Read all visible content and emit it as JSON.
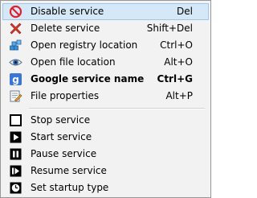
{
  "menu": {
    "items": [
      {
        "label": "Disable service",
        "shortcut": "Del",
        "icon": "disable-icon"
      },
      {
        "label": "Delete service",
        "shortcut": "Shift+Del",
        "icon": "delete-x-icon"
      },
      {
        "label": "Open registry location",
        "shortcut": "Ctrl+O",
        "icon": "registry-icon"
      },
      {
        "label": "Open file location",
        "shortcut": "Alt+O",
        "icon": "eye-icon"
      },
      {
        "label": "Google service name",
        "shortcut": "Ctrl+G",
        "icon": "google-icon"
      },
      {
        "label": "File properties",
        "shortcut": "Alt+P",
        "icon": "file-properties-icon"
      },
      {
        "label": "Stop service",
        "shortcut": "",
        "icon": "stop-icon"
      },
      {
        "label": "Start service",
        "shortcut": "",
        "icon": "play-icon"
      },
      {
        "label": "Pause service",
        "shortcut": "",
        "icon": "pause-icon"
      },
      {
        "label": "Resume service",
        "shortcut": "",
        "icon": "resume-icon"
      },
      {
        "label": "Set startup type",
        "shortcut": "",
        "icon": "clock-icon"
      }
    ],
    "highlighted_item": "Disable service",
    "default_item": "Google service name"
  },
  "colors": {
    "menu_background": "#f2f2f2",
    "highlight": "#d5e8f7",
    "disable_red": "#e0202a",
    "delete_red": "#d63a2c",
    "google_blue": "#3b76d6"
  }
}
